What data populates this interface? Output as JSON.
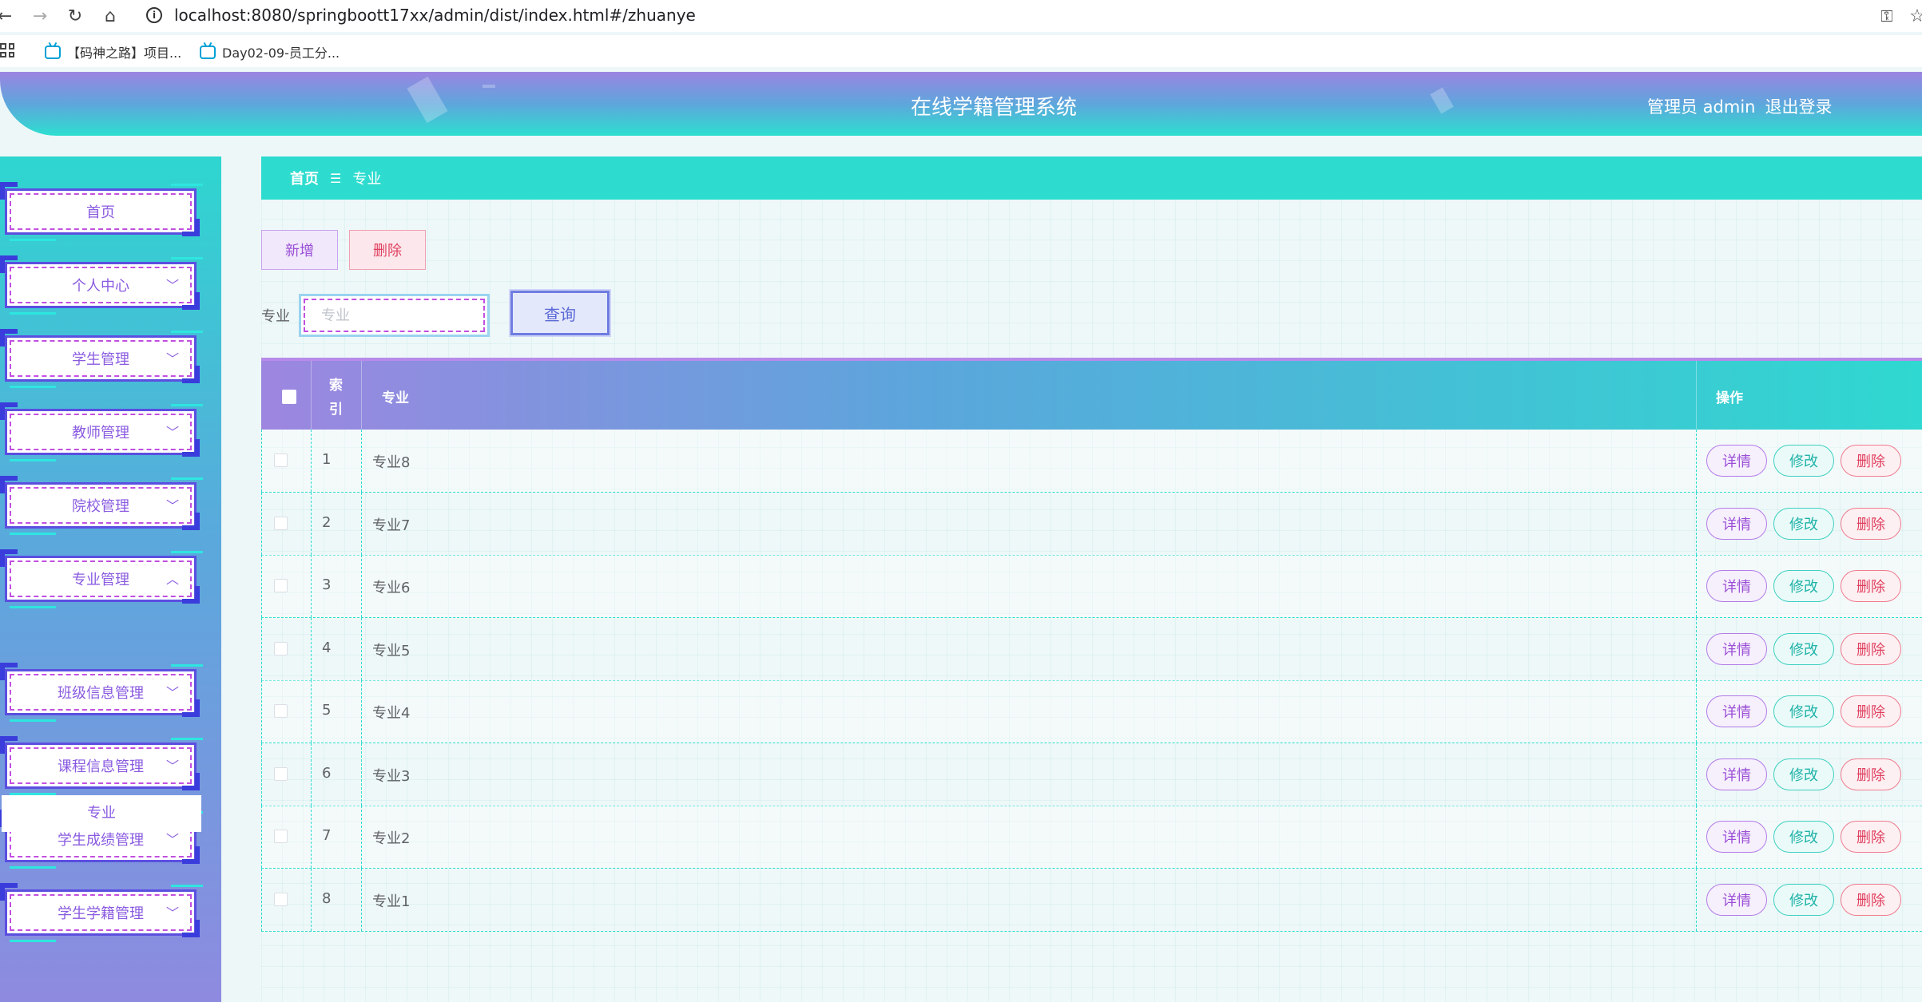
{
  "browser": {
    "url": "localhost:8080/springboott17xx/admin/dist/index.html#/zhuanye",
    "bookmarks": [
      "【码神之路】项目...",
      "Day02-09-员工分..."
    ]
  },
  "header": {
    "title": "在线学籍管理系统",
    "user_label": "管理员 admin",
    "logout": "退出登录"
  },
  "sidebar": {
    "items": [
      {
        "label": "首页",
        "has_chevron": false
      },
      {
        "label": "个人中心",
        "has_chevron": true
      },
      {
        "label": "学生管理",
        "has_chevron": true
      },
      {
        "label": "教师管理",
        "has_chevron": true
      },
      {
        "label": "院校管理",
        "has_chevron": true
      },
      {
        "label": "专业管理",
        "has_chevron": true,
        "expanded": true
      },
      {
        "label": "班级信息管理",
        "has_chevron": true
      },
      {
        "label": "课程信息管理",
        "has_chevron": true
      },
      {
        "label": "学生成绩管理",
        "has_chevron": true
      },
      {
        "label": "学生学籍管理",
        "has_chevron": true
      }
    ],
    "active_submenu": "专业"
  },
  "breadcrumb": {
    "home": "首页",
    "separator": "☰",
    "current": "专业"
  },
  "toolbar": {
    "add_label": "新增",
    "delete_label": "删除"
  },
  "search": {
    "label": "专业",
    "placeholder": "专业",
    "value": "",
    "query_label": "查询"
  },
  "table": {
    "headers": {
      "index": "索引",
      "name": "专业",
      "ops": "操作"
    },
    "rows": [
      {
        "index": "1",
        "name": "专业8"
      },
      {
        "index": "2",
        "name": "专业7"
      },
      {
        "index": "3",
        "name": "专业6"
      },
      {
        "index": "4",
        "name": "专业5"
      },
      {
        "index": "5",
        "name": "专业4"
      },
      {
        "index": "6",
        "name": "专业3"
      },
      {
        "index": "7",
        "name": "专业2"
      },
      {
        "index": "8",
        "name": "专业1"
      }
    ],
    "actions": {
      "detail": "详情",
      "edit": "修改",
      "delete": "删除"
    }
  },
  "colors": {
    "accent_teal": "#2ddccf",
    "accent_purple": "#9c84e2",
    "danger": "#e04060"
  }
}
